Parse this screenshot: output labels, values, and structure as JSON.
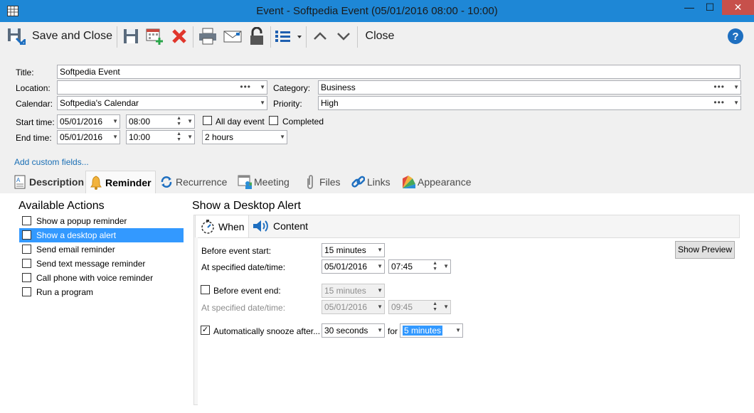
{
  "window": {
    "title": "Event - Softpedia Event (05/01/2016 08:00 - 10:00)",
    "minimize": "—",
    "maximize": "☐",
    "close": "✕"
  },
  "toolbar": {
    "save_close": "Save and Close",
    "close": "Close"
  },
  "form": {
    "title_label": "Title:",
    "title_value": "Softpedia Event",
    "location_label": "Location:",
    "location_value": "",
    "category_label": "Category:",
    "category_value": "Business",
    "calendar_label": "Calendar:",
    "calendar_value": "Softpedia's Calendar",
    "priority_label": "Priority:",
    "priority_value": "High",
    "start_label": "Start time:",
    "start_date": "05/01/2016",
    "start_time": "08:00",
    "end_label": "End time:",
    "end_date": "05/01/2016",
    "end_time": "10:00",
    "all_day": "All day event",
    "completed": "Completed",
    "duration": "2 hours",
    "add_custom": "Add custom fields..."
  },
  "tabs": [
    "Description",
    "Reminder",
    "Recurrence",
    "Meeting",
    "Files",
    "Links",
    "Appearance"
  ],
  "available": {
    "heading": "Available Actions",
    "items": [
      "Show a popup reminder",
      "Show a desktop alert",
      "Send email reminder",
      "Send text message reminder",
      "Call phone with voice reminder",
      "Run a program"
    ],
    "selected_index": 1
  },
  "alert": {
    "heading": "Show a Desktop Alert",
    "subtabs": [
      "When",
      "Content"
    ],
    "before_start_label": "Before event start:",
    "before_start_value": "15 minutes",
    "specified1_label": "At specified date/time:",
    "specified1_date": "05/01/2016",
    "specified1_time": "07:45",
    "before_end_label": "Before event end:",
    "before_end_value": "15 minutes",
    "specified2_label": "At specified date/time:",
    "specified2_date": "05/01/2016",
    "specified2_time": "09:45",
    "snooze_label": "Automatically snooze after...",
    "snooze_value": "30 seconds",
    "for_label": "for",
    "for_value": "5 minutes",
    "show_preview": "Show Preview"
  },
  "colors": {
    "titlebar": "#1e87d6",
    "selection": "#3399ff",
    "link": "#1a6fb5"
  }
}
